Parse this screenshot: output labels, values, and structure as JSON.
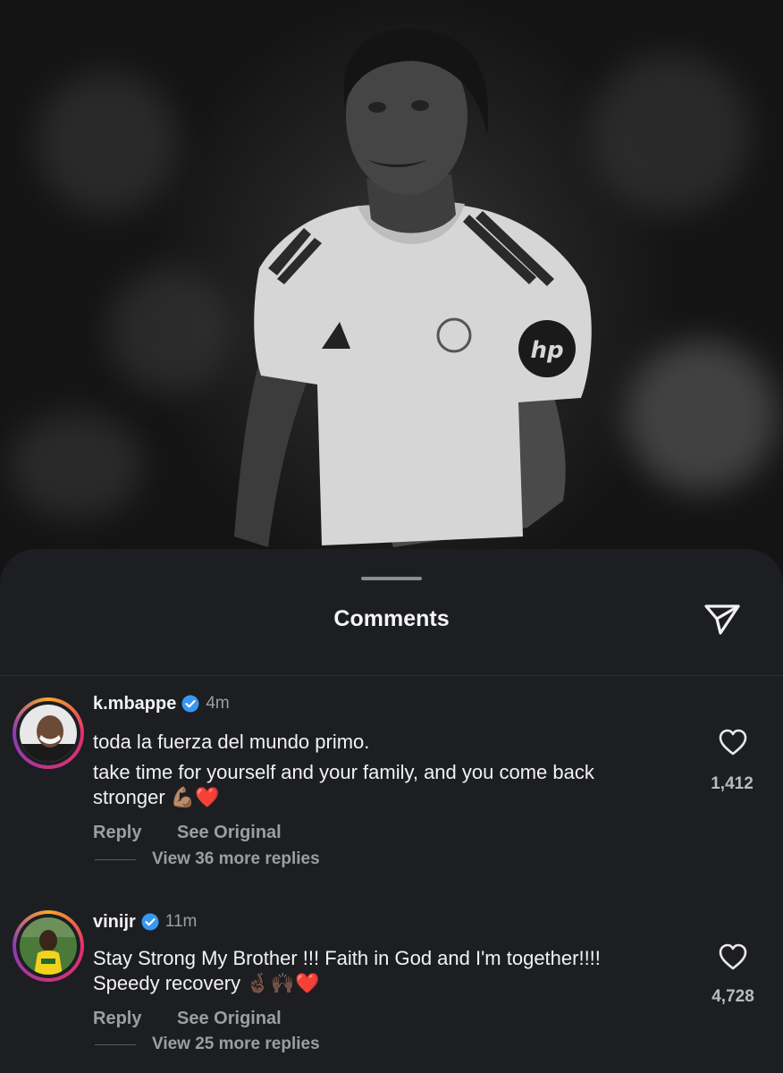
{
  "sheet": {
    "title": "Comments",
    "share_icon": "paper-plane-icon"
  },
  "comments": [
    {
      "username": "k.mbappe",
      "verified": true,
      "time": "4m",
      "lines": [
        "toda la fuerza del mundo primo.",
        "take time for yourself and your family, and you come back",
        "stronger"
      ],
      "emojis": "💪🏽❤️",
      "reply_label": "Reply",
      "see_original_label": "See Original",
      "more_replies": "View 36 more replies",
      "likes": "1,412"
    },
    {
      "username": "vinijr",
      "verified": true,
      "time": "11m",
      "lines": [
        "Stay Strong My Brother !!! Faith in God and I'm together!!!!",
        "Speedy recovery"
      ],
      "emojis": "🤞🏿🙌🏿❤️",
      "reply_label": "Reply",
      "see_original_label": "See Original",
      "more_replies": "View 25 more replies",
      "likes": "4,728"
    }
  ],
  "colors": {
    "sheet_bg": "#1c1e22",
    "verified_blue": "#3897f0",
    "muted_text": "#9c9ea2"
  }
}
